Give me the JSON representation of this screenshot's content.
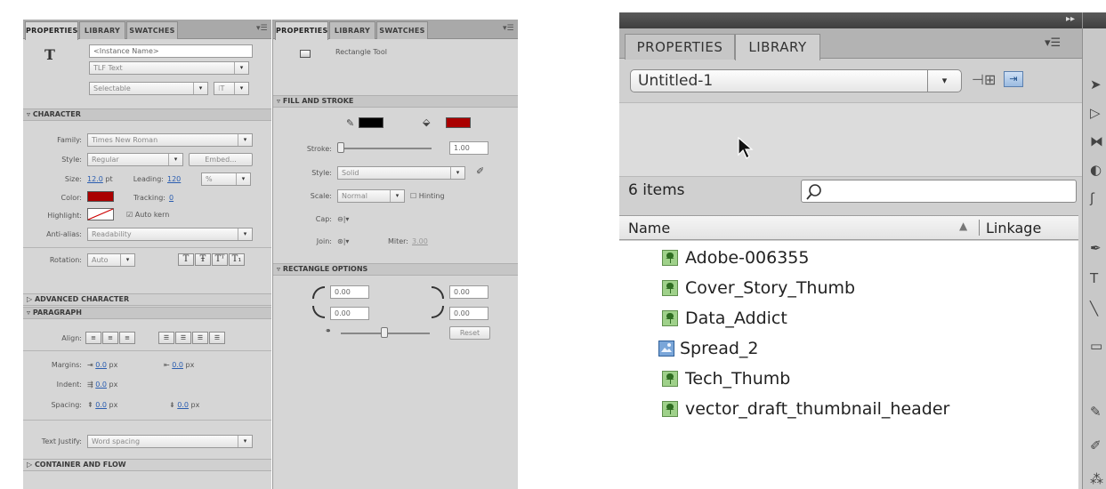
{
  "left_panel": {
    "tabs": [
      "PROPERTIES",
      "LIBRARY",
      "SWATCHES"
    ],
    "tool_glyph": "T",
    "instance_name_placeholder": "<Instance Name>",
    "text_type": "TLF Text",
    "selectable": "Selectable",
    "character": {
      "title": "CHARACTER",
      "family_label": "Family:",
      "family_value": "Times New Roman",
      "style_label": "Style:",
      "style_value": "Regular",
      "embed_button": "Embed...",
      "size_label": "Size:",
      "size_value": "12.0",
      "size_unit": "pt",
      "leading_label": "Leading:",
      "leading_value": "120",
      "leading_unit": "%",
      "color_label": "Color:",
      "color_value": "#aa0000",
      "tracking_label": "Tracking:",
      "tracking_value": "0",
      "highlight_label": "Highlight:",
      "auto_kern_label": "Auto kern",
      "anti_alias_label": "Anti-alias:",
      "anti_alias_value": "Readability",
      "rotation_label": "Rotation:",
      "rotation_value": "Auto"
    },
    "advanced_character_title": "ADVANCED CHARACTER",
    "paragraph": {
      "title": "PARAGRAPH",
      "align_label": "Align:",
      "margins_label": "Margins:",
      "margin_left": "0.0",
      "margin_right": "0.0",
      "indent_label": "Indent:",
      "indent_value": "0.0",
      "spacing_label": "Spacing:",
      "spacing_before": "0.0",
      "spacing_after": "0.0",
      "unit": "px"
    },
    "text_justify_label": "Text Justify:",
    "text_justify_value": "Word spacing",
    "container_title": "CONTAINER AND FLOW"
  },
  "mid_panel": {
    "tabs": [
      "PROPERTIES",
      "LIBRARY",
      "SWATCHES"
    ],
    "tool_name": "Rectangle Tool",
    "fill_stroke_title": "FILL AND STROKE",
    "stroke_color": "#000000",
    "fill_color": "#aa0000",
    "stroke_label": "Stroke:",
    "stroke_value": "1.00",
    "style_label": "Style:",
    "style_value": "Solid",
    "scale_label": "Scale:",
    "scale_value": "Normal",
    "hinting_label": "Hinting",
    "cap_label": "Cap:",
    "join_label": "Join:",
    "miter_label": "Miter:",
    "miter_value": "3.00",
    "rect_options_title": "RECTANGLE OPTIONS",
    "corner_tl": "0.00",
    "corner_tr": "0.00",
    "corner_bl": "0.00",
    "corner_br": "0.00",
    "reset_button": "Reset"
  },
  "library": {
    "tabs": [
      "PROPERTIES",
      "LIBRARY"
    ],
    "document": "Untitled-1",
    "item_count": "6 items",
    "search_placeholder": "",
    "col_name": "Name",
    "col_linkage": "Linkage",
    "items": [
      {
        "name": "Adobe-006355",
        "icon": "bitmap-icon"
      },
      {
        "name": "Cover_Story_Thumb",
        "icon": "bitmap-icon"
      },
      {
        "name": "Data_Addict",
        "icon": "bitmap-icon"
      },
      {
        "name": "Spread_2",
        "icon": "graphic-symbol-icon"
      },
      {
        "name": "Tech_Thumb",
        "icon": "bitmap-icon"
      },
      {
        "name": "vector_draft_thumbnail_header",
        "icon": "bitmap-icon"
      }
    ]
  }
}
